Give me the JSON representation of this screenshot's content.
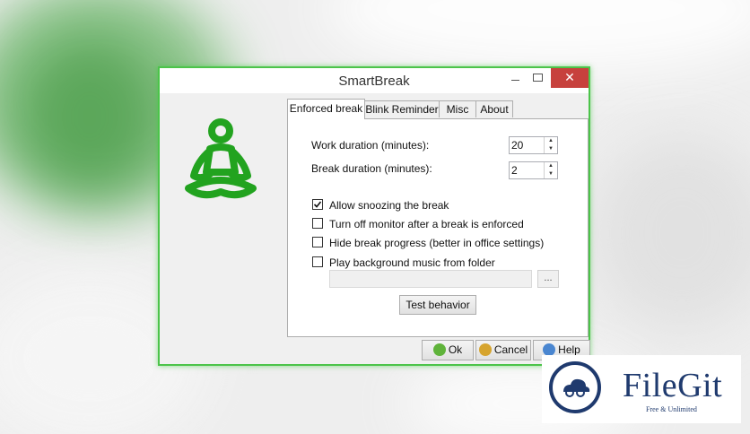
{
  "window": {
    "title": "SmartBreak",
    "controls": {
      "minimize": "–",
      "maximize": "",
      "close": "✕"
    }
  },
  "tabs": [
    {
      "label": "Enforced break",
      "active": true
    },
    {
      "label": "Blink Reminder",
      "active": false
    },
    {
      "label": "Misc",
      "active": false
    },
    {
      "label": "About",
      "active": false
    }
  ],
  "enforced_break": {
    "work_duration": {
      "label": "Work duration (minutes):",
      "value": "20"
    },
    "break_duration": {
      "label": "Break duration (minutes):",
      "value": "2"
    },
    "options": [
      {
        "label": "Allow snoozing the break",
        "checked": true
      },
      {
        "label": "Turn off monitor after a break is enforced",
        "checked": false
      },
      {
        "label": "Hide break progress (better in office settings)",
        "checked": false
      },
      {
        "label": "Play background music from folder",
        "checked": false
      }
    ],
    "folder_value": "",
    "browse_label": "...",
    "test_button": "Test behavior"
  },
  "footer": {
    "ok": "Ok",
    "cancel": "Cancel",
    "help": "Help"
  },
  "watermark": {
    "name": "FileGit",
    "tagline": "Free & Unlimited"
  },
  "colors": {
    "accent_green": "#22a31f",
    "window_border": "#4cc44a",
    "close_red": "#c7413d",
    "filegit_blue": "#1f3a6e"
  }
}
